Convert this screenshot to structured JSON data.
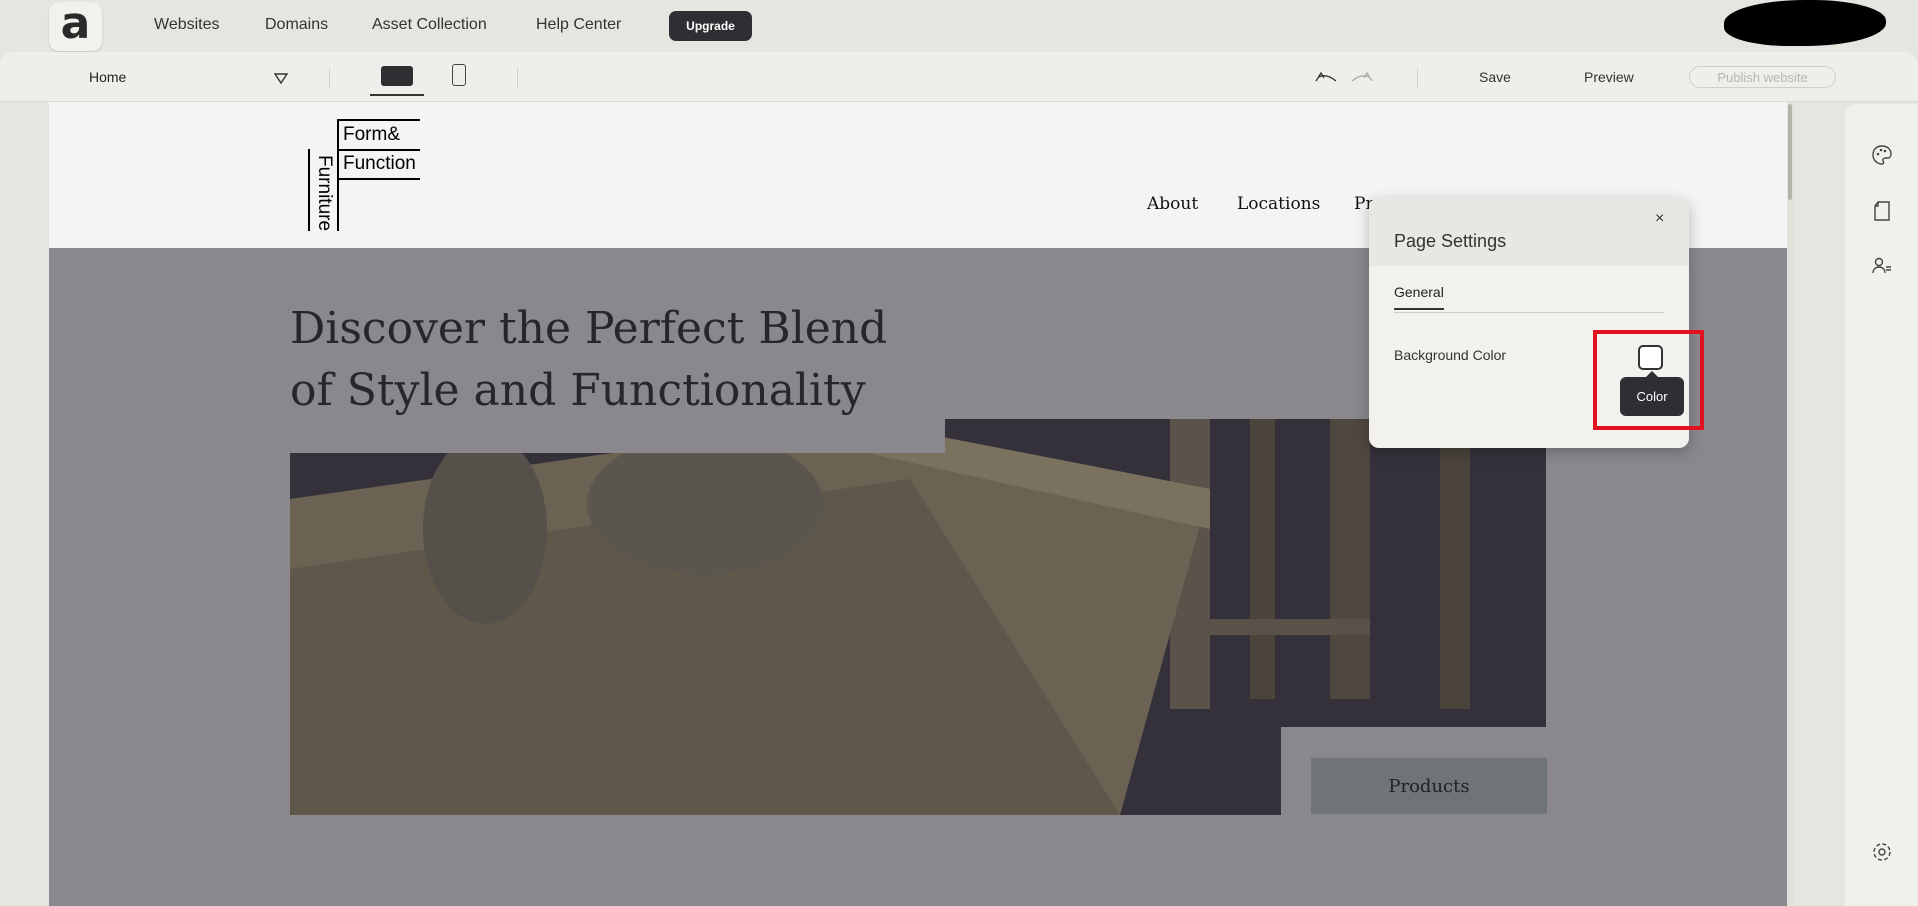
{
  "topnav": {
    "logo_letter": "a",
    "links": [
      "Websites",
      "Domains",
      "Asset Collection",
      "Help Center"
    ],
    "upgrade_label": "Upgrade"
  },
  "toolbar": {
    "page_name": "Home",
    "save_label": "Save",
    "preview_label": "Preview",
    "publish_label": "Publish website"
  },
  "site": {
    "brand_line1": "Form&",
    "brand_line2": "Function",
    "brand_vertical": "Furniture",
    "nav": [
      "About",
      "Locations",
      "Pr"
    ],
    "hero_title": "Discover the Perfect Blend of Style and Functionality",
    "products_button": "Products"
  },
  "page_settings": {
    "title": "Page Settings",
    "close": "×",
    "tab": "General",
    "background_label": "Background Color",
    "tooltip": "Color"
  },
  "colors": {
    "accent_dark": "#2f2e33",
    "highlight": "#e0121f"
  }
}
